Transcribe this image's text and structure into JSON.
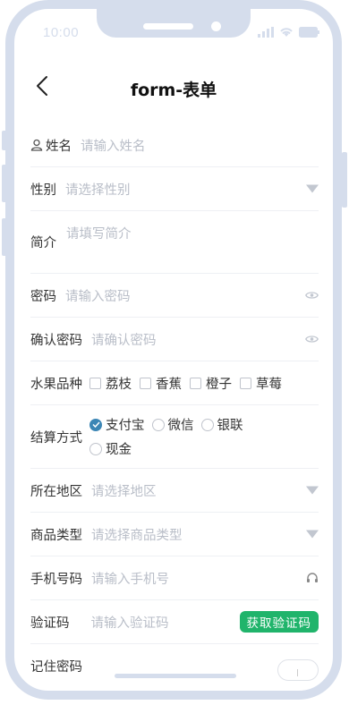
{
  "status": {
    "time": "10:00"
  },
  "nav": {
    "title": "form-表单"
  },
  "form": {
    "name": {
      "label": "姓名",
      "placeholder": "请输入姓名"
    },
    "gender": {
      "label": "性别",
      "placeholder": "请选择性别"
    },
    "intro": {
      "label": "简介",
      "placeholder": "请填写简介"
    },
    "password": {
      "label": "密码",
      "placeholder": "请输入密码"
    },
    "confirm_password": {
      "label": "确认密码",
      "placeholder": "请确认密码"
    },
    "fruit": {
      "label": "水果品种",
      "options": [
        "荔枝",
        "香蕉",
        "橙子",
        "草莓"
      ]
    },
    "payment": {
      "label": "结算方式",
      "options": [
        "支付宝",
        "微信",
        "银联",
        "现金"
      ],
      "selected": "支付宝"
    },
    "region": {
      "label": "所在地区",
      "placeholder": "请选择地区"
    },
    "goods_type": {
      "label": "商品类型",
      "placeholder": "请选择商品类型"
    },
    "phone": {
      "label": "手机号码",
      "placeholder": "请输入手机号"
    },
    "code": {
      "label": "验证码",
      "placeholder": "请输入验证码",
      "button": "获取验证码"
    },
    "remember": {
      "label": "记住密码"
    }
  },
  "colors": {
    "frame": "#d5ddec",
    "accent_green": "#20b46b",
    "radio_blue": "#3c86b5",
    "placeholder": "#b9bec8"
  }
}
